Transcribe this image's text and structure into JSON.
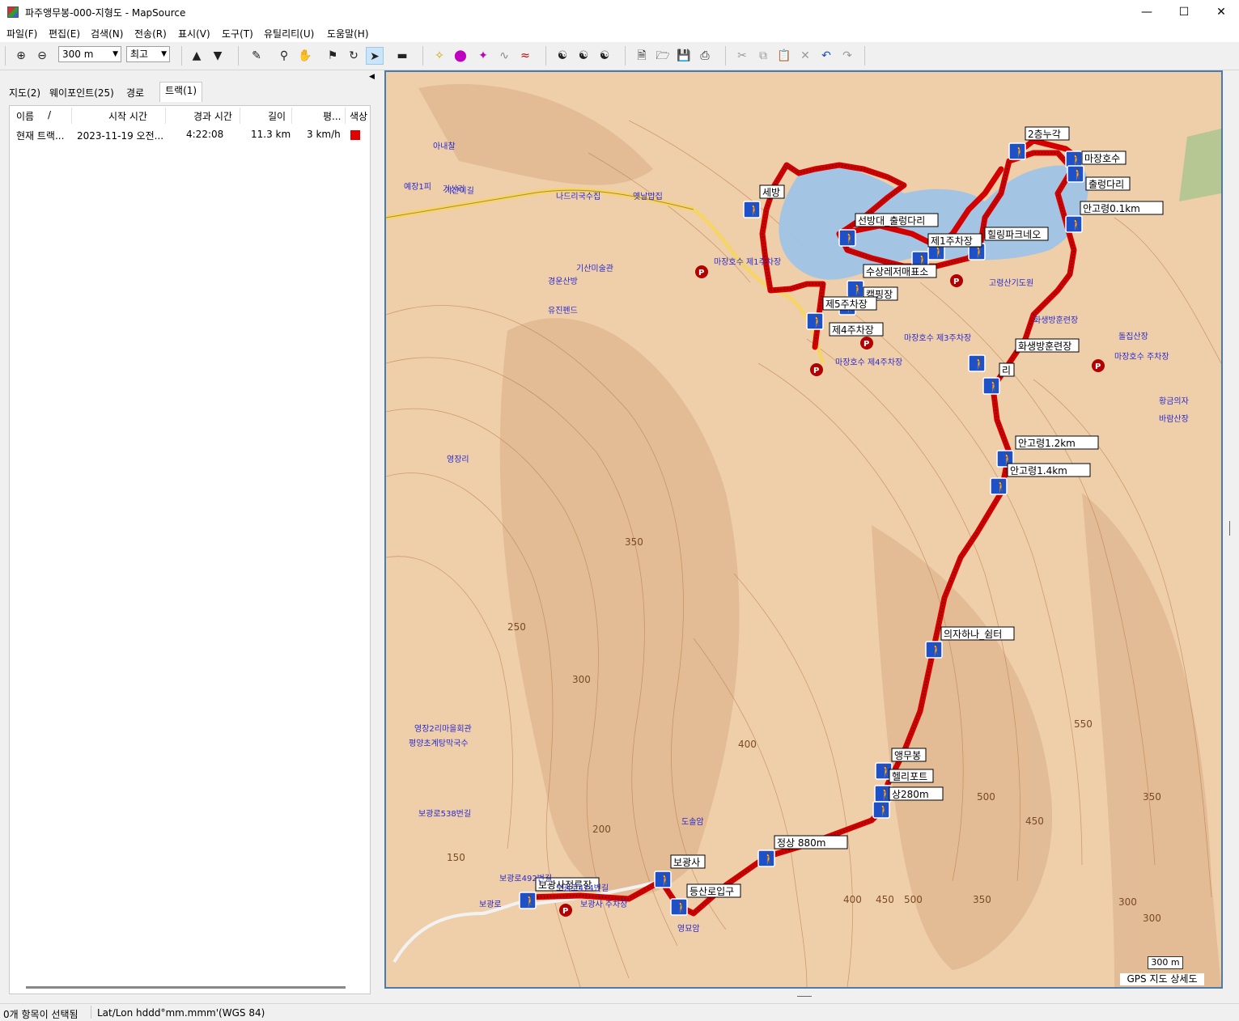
{
  "window": {
    "title": "파주앵무봉-000-지형도 - MapSource",
    "min_icon": "minimize-icon",
    "max_icon": "maximize-icon",
    "close_icon": "close-icon"
  },
  "menu": [
    "파일(F)",
    "편집(E)",
    "검색(N)",
    "전송(R)",
    "표시(V)",
    "도구(T)",
    "유틸리티(U)",
    "도움말(H)"
  ],
  "toolbar": {
    "zoom_value": "300 m",
    "detail_value": "최고"
  },
  "tabs": [
    "지도(2)",
    "웨이포인트(25)",
    "경로",
    "트랙(1)"
  ],
  "track_list": {
    "columns": [
      "이름",
      "/",
      "시작 시간",
      "경과 시간",
      "길이",
      "평...",
      "색상"
    ],
    "rows": [
      {
        "name": "현재 트랙...",
        "start": "2023-11-19 오전...",
        "elapsed": "4:22:08",
        "length": "11.3 km",
        "speed": "3 km/h",
        "color": "#e00000"
      }
    ]
  },
  "map": {
    "waypoints": [
      "2층누각",
      "마장호수",
      "출렁다리",
      "세방",
      "선방대_출렁다리",
      "제1주차장",
      "힐링파크네오",
      "수상레저매표소",
      "안고령0.1km",
      "캠핑장",
      "제5주차장",
      "제4주차장",
      "화생방훈련장",
      "리",
      "안고령1.2km",
      "안고령1.4km",
      "의자하나_쉼터",
      "앵무봉",
      "헬리포트",
      "상280m",
      "정상 880m",
      "보광사",
      "등산로입구",
      "보광사정류장"
    ],
    "contour_labels": [
      "350",
      "250",
      "300",
      "400",
      "200",
      "150",
      "550",
      "500",
      "450",
      "350",
      "300",
      "300",
      "400",
      "450",
      "500",
      "350"
    ],
    "place_labels": [
      "보광로",
      "기산리",
      "아내찰",
      "예장1피",
      "기산이길",
      "나드리국수집",
      "옛날밥집",
      "경운산방",
      "유진펜드",
      "기산미술관",
      "보광로474번길",
      "보광로492번길",
      "보광로538번길",
      "영장리",
      "평양초계탕막국수",
      "영장2리마을회관",
      "도솔암",
      "영묘암",
      "마장호수 제1주차장",
      "마장호수 제3주차장",
      "마장호수 제4주차장",
      "화생방훈련장",
      "돌집산장",
      "황금의자",
      "바람산장",
      "고령산기도원",
      "마장호수 주차장",
      "보광사 주차장"
    ],
    "scale": "300 m",
    "product": "GPS 지도 상세도"
  },
  "status": {
    "selection": "0개 항목이 선택됨",
    "coords": "Lat/Lon hddd°mm.mmm'(WGS 84)"
  }
}
